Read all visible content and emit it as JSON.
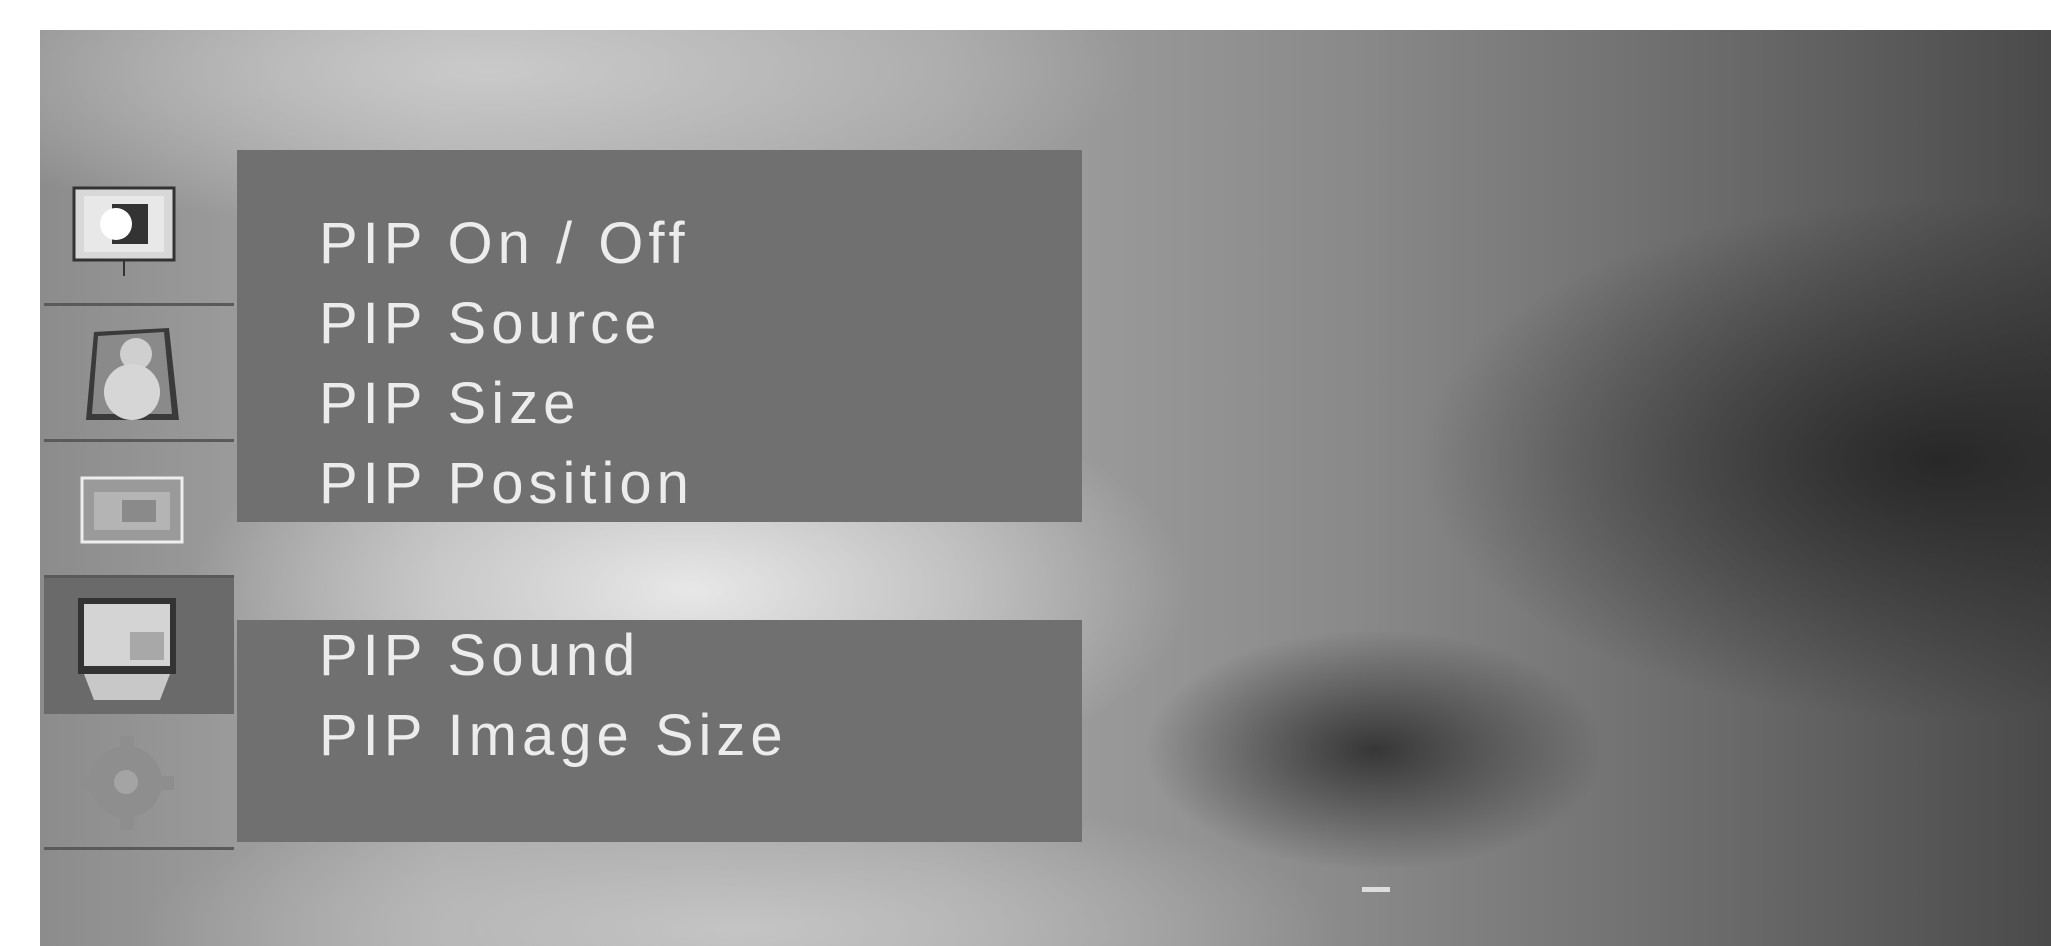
{
  "sidebar": {
    "icons": [
      {
        "name": "picture-icon",
        "selected": false
      },
      {
        "name": "sound-icon",
        "selected": false
      },
      {
        "name": "aspect-ratio-icon",
        "selected": false
      },
      {
        "name": "pip-icon",
        "selected": true
      },
      {
        "name": "settings-gear-icon",
        "selected": false
      }
    ]
  },
  "menu": {
    "items": [
      {
        "label": "PIP On / Off"
      },
      {
        "label": "PIP Source"
      },
      {
        "label": "PIP Size"
      },
      {
        "label": "PIP Position"
      },
      {
        "label": "PIP Sound"
      },
      {
        "label": "PIP Image Size"
      }
    ]
  },
  "colors": {
    "panel": "#707070",
    "text": "#ececec",
    "selected_tab": "#6a6a6a"
  }
}
